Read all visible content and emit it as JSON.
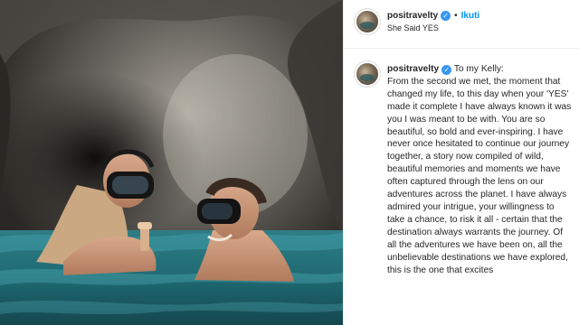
{
  "post": {
    "username": "positravelty",
    "follow_label": "Ikuti",
    "separator": "•",
    "location": "She Said YES",
    "verified_glyph": "✓"
  },
  "caption": {
    "username": "positravelty",
    "greeting": "To my Kelly:",
    "text": "From the second we met, the moment that changed my life, to this day when your 'YES' made it complete I have always known it was you I was meant to be with. You are so beautiful, so bold and ever-inspiring. I have never once hesitated to continue our journey together, a story now compiled of wild, beautiful memories and moments we have often captured through the lens on our adventures across the planet. I have always admired your intrigue, your willingness to take a chance, to risk it all - certain that the destination always warrants the journey. Of all the adventures we have been on, all the unbelievable destinations we have explored, this is the one that excites"
  },
  "icons": {
    "verified": "verified-badge-icon",
    "avatar": "profile-avatar"
  },
  "colors": {
    "link_blue": "#0095f6",
    "verified_blue": "#3897f0",
    "text": "#262626",
    "divider": "#efefef"
  }
}
